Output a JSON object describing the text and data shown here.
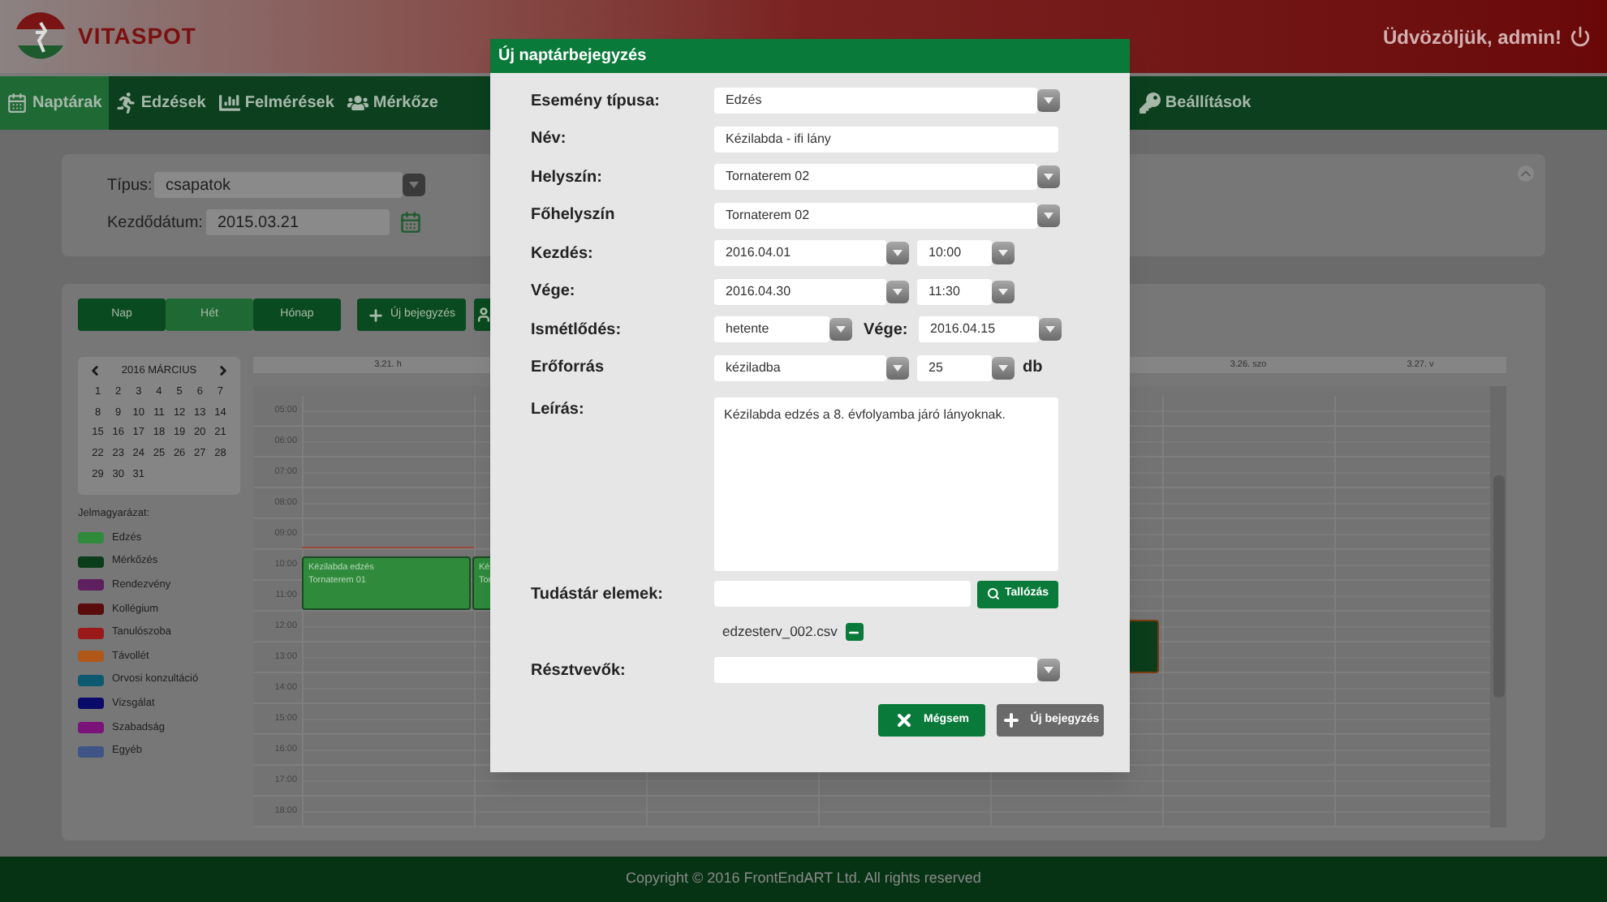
{
  "header": {
    "logo_text": "VITASPOT",
    "welcome": "Üdvözöljük, admin!"
  },
  "nav": [
    {
      "label": "Naptárak",
      "selected": true
    },
    {
      "label": "Edzések",
      "selected": false
    },
    {
      "label": "Felmérések",
      "selected": false
    },
    {
      "label": "Mérkőze",
      "selected": false
    },
    {
      "label": "Beállítások",
      "selected": false
    }
  ],
  "filter": {
    "type_label": "Típus:",
    "type_value": "csapatok",
    "date_label": "Kezdődátum:",
    "date_value": "2015.03.21"
  },
  "calendar": {
    "view_buttons": [
      {
        "label": "Nap",
        "selected": false
      },
      {
        "label": "Hét",
        "selected": true
      },
      {
        "label": "Hónap",
        "selected": false
      }
    ],
    "new_button": "Új bejegyzés",
    "mini_title": "2016 MÁRCIUS",
    "mini_days": [
      "1",
      "2",
      "3",
      "4",
      "5",
      "6",
      "7",
      "8",
      "9",
      "10",
      "11",
      "12",
      "13",
      "14",
      "15",
      "16",
      "17",
      "18",
      "19",
      "20",
      "21",
      "22",
      "23",
      "24",
      "25",
      "26",
      "27",
      "28",
      "29",
      "30",
      "31"
    ],
    "legend_title": "Jelmagyarázat:",
    "legend": [
      {
        "label": "Edzés",
        "color": "#2f8a3c"
      },
      {
        "label": "Mérkőzés",
        "color": "#0b3d1a"
      },
      {
        "label": "Rendezvény",
        "color": "#5e1f5e"
      },
      {
        "label": "Kollégium",
        "color": "#5a0b0b"
      },
      {
        "label": "Tanulószoba",
        "color": "#9a1a1a"
      },
      {
        "label": "Távollét",
        "color": "#b0581a"
      },
      {
        "label": "Orvosi konzultáció",
        "color": "#0d5a70"
      },
      {
        "label": "Vizsgálat",
        "color": "#0a0a6a"
      },
      {
        "label": "Szabadság",
        "color": "#7a127a"
      },
      {
        "label": "Egyéb",
        "color": "#3e5585"
      }
    ],
    "day_headers": [
      {
        "label": "3.21. h"
      },
      {
        "label": "3.26. szo"
      },
      {
        "label": "3.27. v"
      }
    ],
    "times": [
      "05:00",
      "06:00",
      "07:00",
      "08:00",
      "09:00",
      "10:00",
      "11:00",
      "12:00",
      "13:00",
      "14:00",
      "15:00",
      "16:00",
      "17:00",
      "18:00"
    ],
    "events": [
      {
        "lines": [
          "Kézilabda edzés",
          "Tornaterem 01"
        ],
        "color": "#2f8a3c"
      },
      {
        "lines": [
          "Ké",
          "Tor"
        ],
        "color": "#2f8a3c"
      },
      {
        "color": "#0b3d1a"
      }
    ]
  },
  "modal": {
    "title": "Új naptárbejegyzés",
    "fields": [
      {
        "kind": "select",
        "label": "Esemény típusa:",
        "value": "Edzés"
      },
      {
        "kind": "text",
        "label": "Név:",
        "value": "Kézilabda - ifi lány"
      },
      {
        "kind": "select",
        "label": "Helyszín:",
        "value": "Tornaterem 02"
      },
      {
        "kind": "select",
        "label": "Főhelyszín",
        "value": "Tornaterem 02"
      },
      {
        "kind": "datetime",
        "label": "Kezdés:",
        "date": "2016.04.01",
        "time": "10:00"
      },
      {
        "kind": "datetime",
        "label": "Vége:",
        "date": "2016.04.30",
        "time": "11:30"
      },
      {
        "kind": "repeat",
        "label": "Ismétlődés:",
        "value": "hetente",
        "end_label": "Vége:",
        "end_value": "2016.04.15"
      },
      {
        "kind": "resource",
        "label": "Erőforrás",
        "value": "kéziladba",
        "amount": "25",
        "unit": "db"
      },
      {
        "kind": "textarea",
        "label": "Leírás:",
        "value": "Kézilabda edzés a 8. évfolyamba járó lányoknak."
      },
      {
        "kind": "browse",
        "label": "Tudástár elemek:",
        "button": "Tallózás"
      },
      {
        "kind": "file",
        "value": "edzesterv_002.csv"
      },
      {
        "kind": "select",
        "label": "Résztvevők:"
      }
    ],
    "buttons": [
      {
        "kind": "cancel",
        "label": "Mégsem"
      },
      {
        "kind": "add",
        "label": "Új bejegyzés"
      }
    ]
  },
  "footer": "Copyright © 2016 FrontEndART Ltd. All rights reserved"
}
